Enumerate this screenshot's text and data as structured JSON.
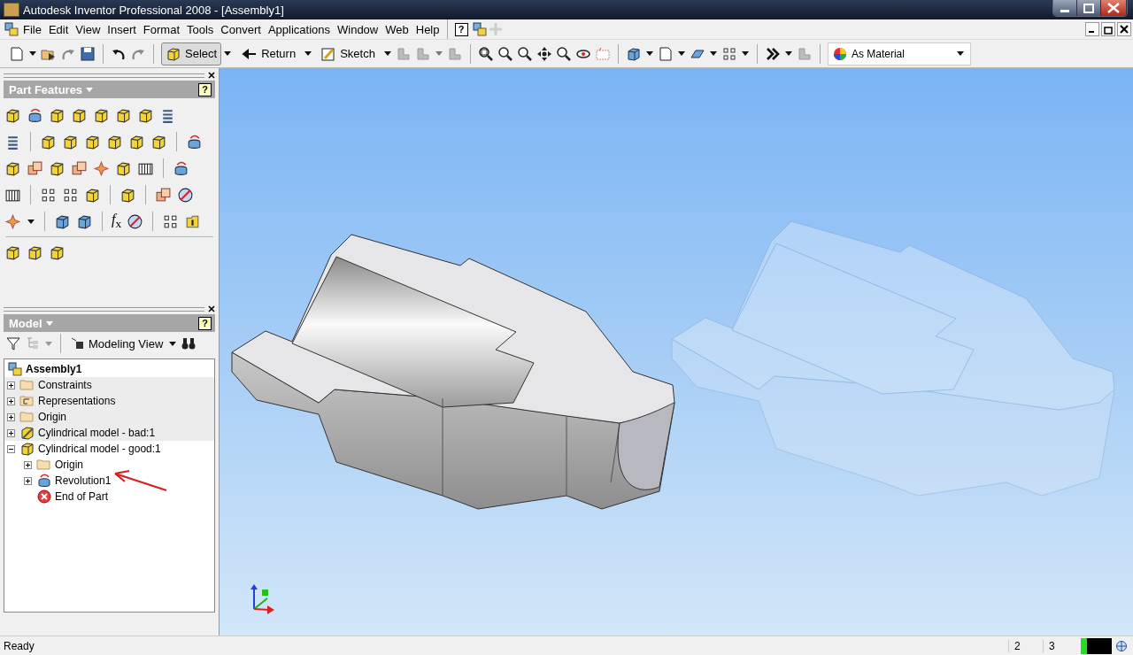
{
  "window": {
    "title": "Autodesk Inventor Professional 2008 - [Assembly1]"
  },
  "menu": [
    "File",
    "Edit",
    "View",
    "Insert",
    "Format",
    "Tools",
    "Convert",
    "Applications",
    "Window",
    "Web",
    "Help"
  ],
  "menu_help_glyph": "?",
  "toolbar": {
    "select": {
      "label": "Select",
      "selected": true
    },
    "return": {
      "label": "Return"
    },
    "sketch": {
      "label": "Sketch"
    },
    "color_style": {
      "value": "As Material"
    }
  },
  "part_features": {
    "title": "Part Features",
    "help_glyph": "?",
    "fx_label": "*f*$_{x}$"
  },
  "model_panel": {
    "title": "Model",
    "help_glyph": "?",
    "view": "Modeling View"
  },
  "tree": {
    "label": "Assembly1",
    "kind": "assembly",
    "shaded": false,
    "children": [
      {
        "label": "Constraints",
        "kind": "folder",
        "shaded": true,
        "expanded": false
      },
      {
        "label": "Representations",
        "kind": "representations",
        "shaded": true,
        "expanded": false
      },
      {
        "label": "Origin",
        "kind": "folder",
        "shaded": true,
        "expanded": false
      },
      {
        "label": "Cylindrical model - bad:1",
        "kind": "part-bad",
        "shaded": true,
        "expanded": false
      },
      {
        "label": "Cylindrical model - good:1",
        "kind": "part",
        "shaded": false,
        "expanded": true,
        "children": [
          {
            "label": "Origin",
            "kind": "folder",
            "shaded": false,
            "expanded": false
          },
          {
            "label": "Revolution1",
            "kind": "feature",
            "shaded": false,
            "expanded": false
          },
          {
            "label": "End of Part",
            "kind": "end",
            "shaded": false
          }
        ]
      }
    ]
  },
  "status_bar": {
    "message": "Ready",
    "field_1": "2",
    "field_2": "3"
  }
}
